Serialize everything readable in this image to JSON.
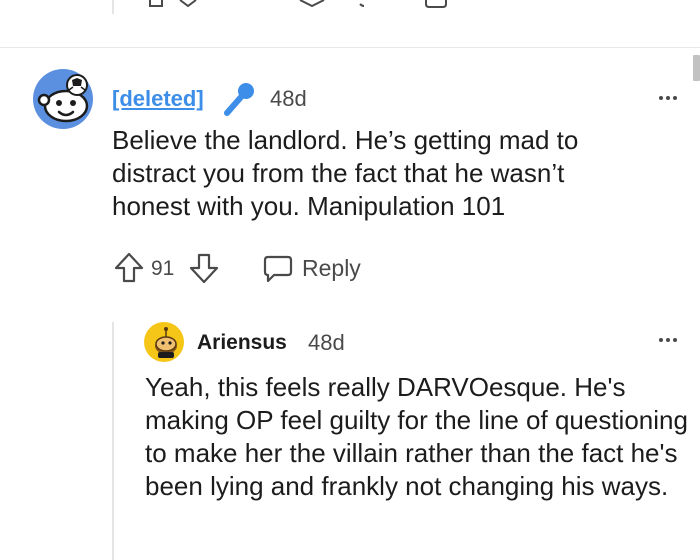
{
  "comment1": {
    "author": "[deleted]",
    "age": "48d",
    "body": "Believe the landlord. He’s getting mad to distract you from the fact that he wasn’t honest with you. Manipulation 101",
    "votes": "91",
    "reply_label": "Reply"
  },
  "comment2": {
    "author": "Ariensus",
    "age": "48d",
    "body": "Yeah, this feels really DARVOesque. He's making OP feel guilty for the line of questioning to make her the villain rather than the fact he's been lying and frankly not changing his ways."
  },
  "colors": {
    "accent": "#3d8ee8",
    "avatar_bg": "#5b8fe0",
    "avatar_yellow": "#f5c518",
    "text": "#1c1c1c",
    "muted": "#4a4a4a",
    "divider": "#e8e8e8"
  }
}
